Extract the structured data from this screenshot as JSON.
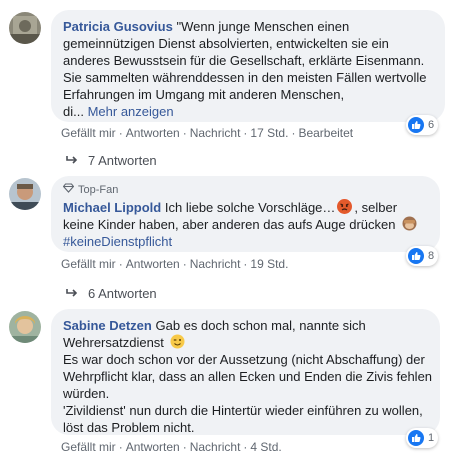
{
  "comments": [
    {
      "author": "Patricia Gusovius",
      "lines": [
        "\"Wenn junge Menschen einen",
        "gemeinnützigen Dienst absolvierten, entwickelten sie ein",
        "anderes Bewusstsein für die Gesellschaft, erklärte Eisenmann.",
        "Sie sammelten währenddessen in den meisten Fällen wertvolle",
        "Erfahrungen im Umgang mit anderen Menschen,"
      ],
      "truncated_text": "di...",
      "more_label": "Mehr anzeigen",
      "actions": [
        "Gefällt mir",
        "Antworten",
        "Nachricht",
        "17 Std.",
        "Bearbeitet"
      ],
      "reaction_count": "6",
      "replies_label": "7 Antworten"
    },
    {
      "badge": "Top-Fan",
      "author": "Michael Lippold",
      "lines": [
        "Ich liebe solche Vorschläge…",
        ", selber",
        "keine Kinder haben, aber anderen das aufs Auge drücken"
      ],
      "hashtag": "#keineDienstpflicht",
      "actions": [
        "Gefällt mir",
        "Antworten",
        "Nachricht",
        "19 Std."
      ],
      "reaction_count": "8",
      "replies_label": "6 Antworten"
    },
    {
      "author": "Sabine Detzen",
      "lines": [
        "Gab es doch schon mal, nannte sich",
        "Wehrersatzdienst",
        "Es war doch schon vor der Aussetzung (nicht Abschaffung) der",
        "Wehrpflicht klar, dass an allen Ecken und Enden die Zivis fehlen",
        "würden.",
        "'Zivildienst' nun durch die Hintertür wieder einführen zu wollen,",
        "löst das Problem nicht."
      ],
      "actions": [
        "Gefällt mir",
        "Antworten",
        "Nachricht",
        "4 Std."
      ],
      "reaction_count": "1"
    }
  ],
  "colors": {
    "link": "#365899",
    "bubble": "#f0f2f5",
    "like_blue": "#1877f2",
    "meta": "#606770"
  }
}
